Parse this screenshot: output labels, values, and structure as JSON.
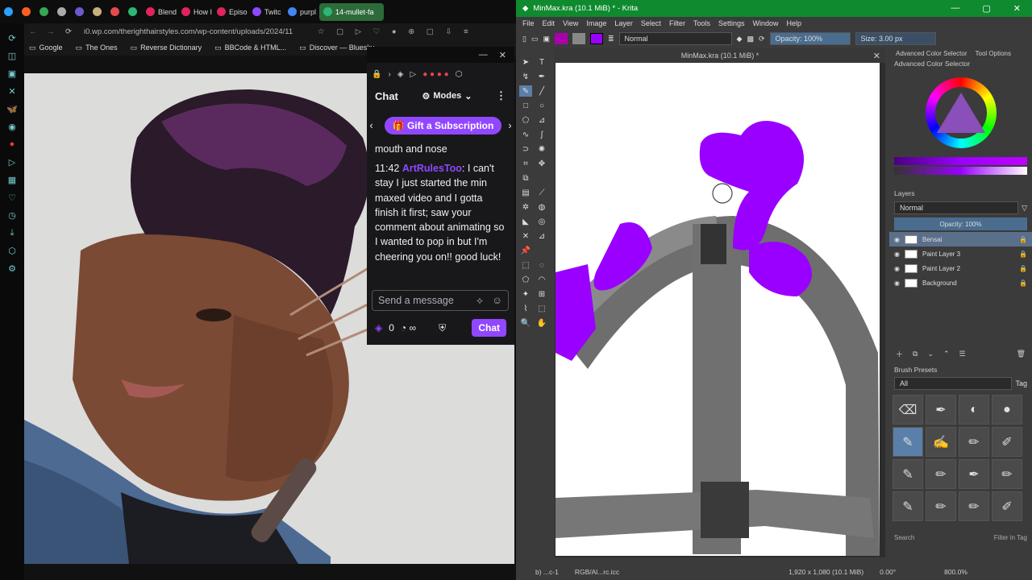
{
  "browser": {
    "tabs": [
      {
        "label": "",
        "color": "#2aa0ff"
      },
      {
        "label": "",
        "color": "#ff5f1f"
      },
      {
        "label": "",
        "color": "#34a853"
      },
      {
        "label": "",
        "color": "#aaaaaa"
      },
      {
        "label": "",
        "color": "#6a5acd"
      },
      {
        "label": "",
        "color": "#c8b07a"
      },
      {
        "label": "",
        "color": "#e54b4b"
      },
      {
        "label": "",
        "color": "#2bb673"
      },
      {
        "label": "Blend",
        "color": "#e0245e"
      },
      {
        "label": "How I",
        "color": "#e0245e"
      },
      {
        "label": "Episo",
        "color": "#e0245e"
      },
      {
        "label": "Twitc",
        "color": "#9147ff"
      },
      {
        "label": "purpl",
        "color": "#4285f4"
      },
      {
        "label": "14-mullet-fa",
        "color": "#2bb673",
        "active": true
      }
    ],
    "url": "i0.wp.com/therighthairstyles.com/wp-content/uploads/2024/11",
    "bookmarks": [
      "Google",
      "The Ones",
      "Reverse Dictionary",
      "BBCode & HTML...",
      "Discover — Bluesky"
    ]
  },
  "chat": {
    "title": "Chat",
    "modes_label": "Modes",
    "gift_label": "Gift a Subscription",
    "prev_text": "mouth and nose",
    "message": {
      "time": "11:42",
      "user": "ArtRulesToo",
      "text": ": I can't stay I just started the min maxed video and I gotta finish it first; saw your comment about animating so I wanted to pop in but I'm cheering you on!! good luck!"
    },
    "input_placeholder": "Send a message",
    "points": "0",
    "chat_button": "Chat",
    "colors": {
      "accent": "#9147ff",
      "background": "#18181b"
    }
  },
  "krita": {
    "window_title": "MinMax.kra (10.1 MiB) * - Krita",
    "menu": [
      "File",
      "Edit",
      "View",
      "Image",
      "Layer",
      "Select",
      "Filter",
      "Tools",
      "Settings",
      "Window",
      "Help"
    ],
    "blend_mode": "Normal",
    "opacity": "Opacity: 100%",
    "size": "Size: 3.00 px",
    "document_tab": "MinMax.kra (10.1 MiB) *",
    "docker_tabs": [
      "Advanced Color Selector",
      "Tool Options"
    ],
    "color_selector_title": "Advanced Color Selector",
    "layers_title": "Layers",
    "layers_blend": "Normal",
    "layers_opacity": "Opacity: 100%",
    "layers": [
      {
        "name": "Bensai",
        "selected": true
      },
      {
        "name": "Paint Layer 3",
        "selected": false
      },
      {
        "name": "Paint Layer 2",
        "selected": false
      },
      {
        "name": "Background",
        "selected": false
      }
    ],
    "brush_presets_title": "Brush Presets",
    "brush_filter": "All",
    "brush_tag": "Tag",
    "search_placeholder": "Search",
    "filter_in_tag": "Filter in Tag",
    "status": {
      "tool": "b) ...c-1",
      "colorspace": "RGB/Al...rc.icc",
      "dimensions": "1,920 x 1,080 (10.1 MiB)",
      "rotation": "0.00°",
      "zoom": "800.0%"
    },
    "colors": {
      "titlebar": "#0f8a2e",
      "paint": "#9a00ff",
      "panel": "#3b3b3b"
    }
  }
}
